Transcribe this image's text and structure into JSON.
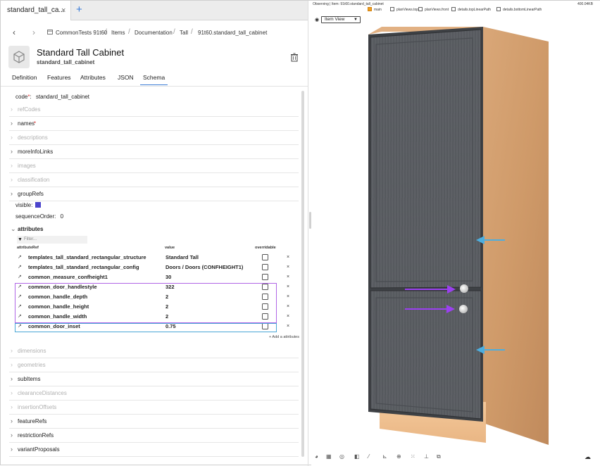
{
  "tab": {
    "title": "standard_tall_ca...",
    "close": "×",
    "add": "+"
  },
  "nav": {
    "back": "‹",
    "forward": "›",
    "breadcrumbs": [
      "CommonTests 91t60",
      "Items",
      "Documentation",
      "Tall",
      "91t60.standard_tall_cabinet"
    ]
  },
  "item": {
    "title": "Standard Tall Cabinet",
    "code": "standard_tall_cabinet"
  },
  "subtabs": [
    "Definition",
    "Features",
    "Attributes",
    "JSON",
    "Schema"
  ],
  "schema": {
    "code_label": "code",
    "code_value": "standard_tall_cabinet",
    "rows_top": [
      {
        "label": "refCodes",
        "dim": true
      },
      {
        "label": "names",
        "dim": false,
        "required": true
      },
      {
        "label": "descriptions",
        "dim": true
      },
      {
        "label": "moreInfoLinks",
        "dim": false
      },
      {
        "label": "images",
        "dim": true
      },
      {
        "label": "classification",
        "dim": true
      },
      {
        "label": "groupRefs",
        "dim": false
      }
    ],
    "visible_label": "visible:",
    "sequence_label": "sequenceOrder:",
    "sequence_value": "0",
    "attributes_label": "attributes",
    "filter_placeholder": "Filter...",
    "columns": {
      "ref": "attributeRef",
      "value": "value",
      "overridable": "overridable"
    },
    "attribute_rows": [
      {
        "name": "templates_tall_standard_rectangular_structure",
        "value": "Standard Tall"
      },
      {
        "name": "templates_tall_standard_rectangular_config",
        "value": "Doors / Doors (CONFHEIGHT1)"
      },
      {
        "name": "common_measure_confheight1",
        "value": "30"
      },
      {
        "name": "common_door_handlestyle",
        "value": "322"
      },
      {
        "name": "common_handle_depth",
        "value": "2"
      },
      {
        "name": "common_handle_height",
        "value": "2"
      },
      {
        "name": "common_handle_width",
        "value": "2"
      },
      {
        "name": "common_door_inset",
        "value": "0.75"
      }
    ],
    "add_attribute": "+ Add a attributes",
    "rows_bottom": [
      {
        "label": "dimensions",
        "dim": true
      },
      {
        "label": "geometries",
        "dim": true
      },
      {
        "label": "subItems",
        "dim": false
      },
      {
        "label": "clearanceDistances",
        "dim": true
      },
      {
        "label": "insertionOffsets",
        "dim": true
      },
      {
        "label": "featureRefs",
        "dim": false
      },
      {
        "label": "restrictionRefs",
        "dim": false
      },
      {
        "label": "variantProposals",
        "dim": false
      }
    ]
  },
  "viewer": {
    "status": "Observing | Item: 91t60.standard_tall_cabinet",
    "zoom": "400.04KB",
    "layers": [
      {
        "label": "main",
        "checked": true
      },
      {
        "label": "planViews.top",
        "checked": false
      },
      {
        "label": "planViews.front",
        "checked": false
      },
      {
        "label": "details.topLinearPath",
        "checked": false
      },
      {
        "label": "details.bottomLinearPath",
        "checked": false
      }
    ],
    "view_select": "Item View"
  },
  "colors": {
    "accent": "#3a7bd5",
    "highlight_purple": "#b065e6",
    "highlight_blue": "#4aa6d6",
    "arrow_purple": "#9b40f0",
    "arrow_blue": "#4eaede"
  }
}
